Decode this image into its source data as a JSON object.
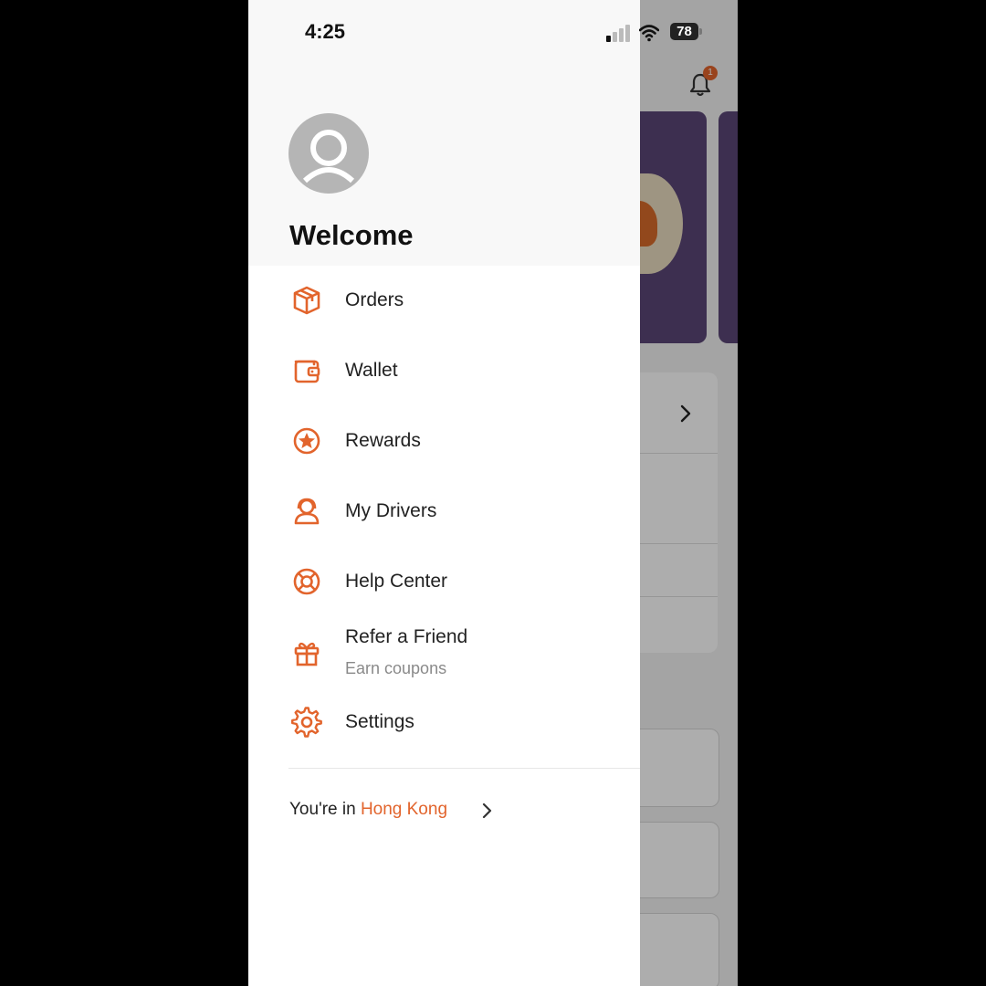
{
  "status_bar": {
    "time": "4:25",
    "battery": "78"
  },
  "background_app": {
    "notification_count": "1"
  },
  "drawer": {
    "welcome": "Welcome",
    "menu": [
      {
        "label": "Orders",
        "icon": "box-icon"
      },
      {
        "label": "Wallet",
        "icon": "wallet-icon"
      },
      {
        "label": "Rewards",
        "icon": "rewards-icon"
      },
      {
        "label": "My Drivers",
        "icon": "drivers-icon"
      },
      {
        "label": "Help Center",
        "icon": "lifebuoy-icon"
      },
      {
        "label": "Refer a Friend",
        "sublabel": "Earn coupons",
        "icon": "gift-icon"
      },
      {
        "label": "Settings",
        "icon": "gear-icon"
      }
    ],
    "region": {
      "prefix": "You're in",
      "city": "Hong Kong"
    }
  },
  "colors": {
    "accent": "#e2642c",
    "banner": "#5a4676"
  }
}
